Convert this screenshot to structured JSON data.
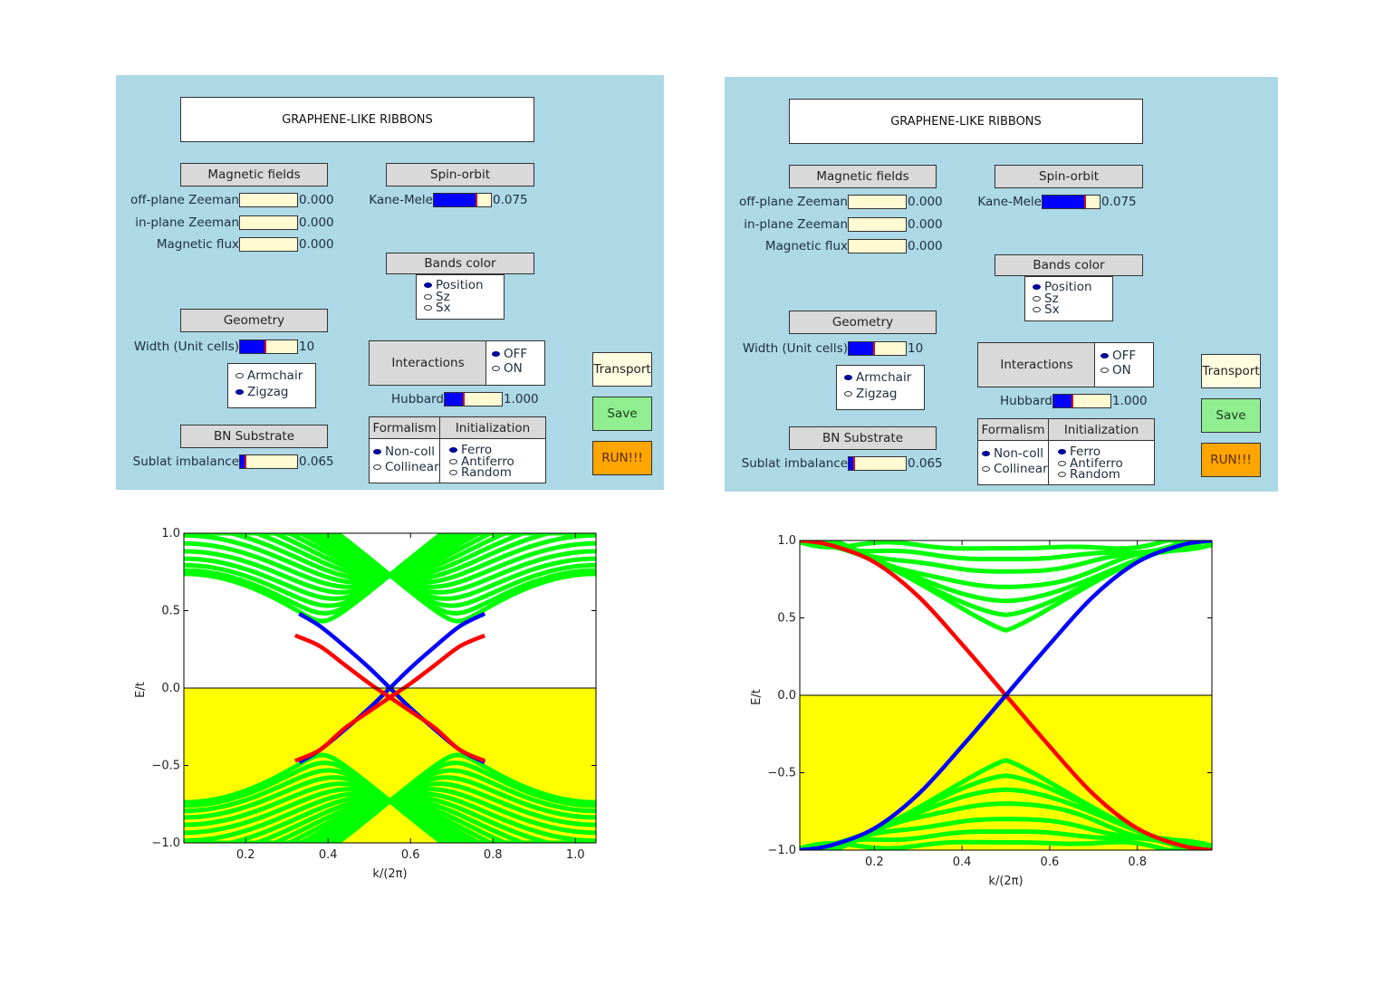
{
  "panels": [
    {
      "id": "left",
      "title": "GRAPHENE-LIKE RIBBONS",
      "magnetic_fields": {
        "header": "Magnetic fields",
        "sliders": [
          {
            "label": "off-plane Zeeman",
            "value": "0.000",
            "fraction": 0.0
          },
          {
            "label": "in-plane Zeeman",
            "value": "0.000",
            "fraction": 0.0
          },
          {
            "label": "Magnetic flux",
            "value": "0.000",
            "fraction": 0.0
          }
        ]
      },
      "spin_orbit": {
        "header": "Spin-orbit",
        "slider": {
          "label": "Kane-Mele",
          "value": "0.075",
          "fraction": 0.75
        }
      },
      "bands_color": {
        "header": "Bands color",
        "options": [
          {
            "label": "Position",
            "selected": true
          },
          {
            "label": "Sz",
            "selected": false
          },
          {
            "label": "Sx",
            "selected": false
          }
        ]
      },
      "geometry": {
        "header": "Geometry",
        "slider": {
          "label": "Width (Unit cells)",
          "value": "10",
          "fraction": 0.45
        },
        "options": [
          {
            "label": "Armchair",
            "selected": false
          },
          {
            "label": "Zigzag",
            "selected": true
          }
        ]
      },
      "bn_substrate": {
        "header": "BN Substrate",
        "slider": {
          "label": "Sublat imbalance",
          "value": "0.065",
          "fraction": 0.1
        }
      },
      "interactions": {
        "header": "Interactions",
        "options": [
          {
            "label": "OFF",
            "selected": true
          },
          {
            "label": "ON",
            "selected": false
          }
        ],
        "slider": {
          "label": "Hubbard",
          "value": "1.000",
          "fraction": 0.33
        }
      },
      "formalism": {
        "header": "Formalism",
        "options": [
          {
            "label": "Non-coll",
            "selected": true
          },
          {
            "label": "Collinear",
            "selected": false
          }
        ]
      },
      "initialization": {
        "header": "Initialization",
        "options": [
          {
            "label": "Ferro",
            "selected": true
          },
          {
            "label": "Antiferro",
            "selected": false
          },
          {
            "label": "Random",
            "selected": false
          }
        ]
      },
      "buttons": {
        "transport": "Transport",
        "save": "Save",
        "run": "RUN!!!"
      }
    },
    {
      "id": "right",
      "title": "GRAPHENE-LIKE RIBBONS",
      "magnetic_fields": {
        "header": "Magnetic fields",
        "sliders": [
          {
            "label": "off-plane Zeeman",
            "value": "0.000",
            "fraction": 0.0
          },
          {
            "label": "in-plane Zeeman",
            "value": "0.000",
            "fraction": 0.0
          },
          {
            "label": "Magnetic flux",
            "value": "0.000",
            "fraction": 0.0
          }
        ]
      },
      "spin_orbit": {
        "header": "Spin-orbit",
        "slider": {
          "label": "Kane-Mele",
          "value": "0.075",
          "fraction": 0.75
        }
      },
      "bands_color": {
        "header": "Bands color",
        "options": [
          {
            "label": "Position",
            "selected": true
          },
          {
            "label": "Sz",
            "selected": false
          },
          {
            "label": "Sx",
            "selected": false
          }
        ]
      },
      "geometry": {
        "header": "Geometry",
        "slider": {
          "label": "Width (Unit cells)",
          "value": "10",
          "fraction": 0.45
        },
        "options": [
          {
            "label": "Armchair",
            "selected": true
          },
          {
            "label": "Zigzag",
            "selected": false
          }
        ]
      },
      "bn_substrate": {
        "header": "BN Substrate",
        "slider": {
          "label": "Sublat imbalance",
          "value": "0.065",
          "fraction": 0.1
        }
      },
      "interactions": {
        "header": "Interactions",
        "options": [
          {
            "label": "OFF",
            "selected": true
          },
          {
            "label": "ON",
            "selected": false
          }
        ],
        "slider": {
          "label": "Hubbard",
          "value": "1.000",
          "fraction": 0.33
        }
      },
      "formalism": {
        "header": "Formalism",
        "options": [
          {
            "label": "Non-coll",
            "selected": true
          },
          {
            "label": "Collinear",
            "selected": false
          }
        ]
      },
      "initialization": {
        "header": "Initialization",
        "options": [
          {
            "label": "Ferro",
            "selected": true
          },
          {
            "label": "Antiferro",
            "selected": false
          },
          {
            "label": "Random",
            "selected": false
          }
        ]
      },
      "buttons": {
        "transport": "Transport",
        "save": "Save",
        "run": "RUN!!!"
      }
    }
  ],
  "colors": {
    "panel_bg": "#add8e6",
    "header_bg": "#d9d9d9",
    "slider_track": "#fffad2",
    "slider_fill": "#0000ff",
    "bulk_band": "#00ff00",
    "edge_left": "#0000ff",
    "edge_right": "#ff0000",
    "occupied_fill": "#ffff00",
    "transport_btn": "#fffde0",
    "save_btn": "#90ee90",
    "run_btn": "#ffa500"
  },
  "chart_data": [
    {
      "type": "line",
      "title": "",
      "xlabel": "k/(2π)",
      "ylabel": "E/t",
      "xlim": [
        0.05,
        1.05
      ],
      "ylim": [
        -1.0,
        1.0
      ],
      "xticks": [
        0.2,
        0.4,
        0.6,
        0.8,
        1.0
      ],
      "xtick_labels": [
        "0.2",
        "0.4",
        "0.6",
        "0.8",
        "1.0"
      ],
      "yticks": [
        -1.0,
        -0.5,
        0.0,
        0.5,
        1.0
      ],
      "ytick_labels": [
        "−1.0",
        "−0.5",
        "0.0",
        "0.5",
        "1.0"
      ],
      "grid": false,
      "fermi_level": 0.0,
      "fill_below_fermi": true,
      "model": {
        "edge": "zigzag",
        "width": 10,
        "kane_mele": 0.075,
        "sublattice_imbalance": 0.065,
        "k_center": 0.55
      },
      "edge_states": [
        {
          "name": "edge-state-blue",
          "color": "blue",
          "k": [
            0.33,
            0.38,
            0.44,
            0.5,
            0.55,
            0.6,
            0.66,
            0.72,
            0.78
          ],
          "E": [
            0.48,
            0.4,
            0.27,
            0.13,
            0.0,
            -0.13,
            -0.27,
            -0.4,
            -0.48
          ]
        },
        {
          "name": "edge-state-blue-2",
          "color": "blue",
          "k": [
            0.33,
            0.38,
            0.44,
            0.5,
            0.55,
            0.6,
            0.66,
            0.72,
            0.78
          ],
          "E": [
            -0.48,
            -0.4,
            -0.27,
            -0.13,
            0.0,
            0.13,
            0.27,
            0.4,
            0.48
          ]
        },
        {
          "name": "edge-state-red",
          "color": "red",
          "k": [
            0.32,
            0.38,
            0.44,
            0.5,
            0.55,
            0.6,
            0.66,
            0.72,
            0.78
          ],
          "E": [
            0.34,
            0.27,
            0.15,
            0.03,
            -0.06,
            -0.15,
            -0.26,
            -0.4,
            -0.47
          ]
        },
        {
          "name": "edge-state-red-2",
          "color": "red",
          "k": [
            0.32,
            0.38,
            0.44,
            0.5,
            0.55,
            0.6,
            0.66,
            0.72,
            0.78
          ],
          "E": [
            -0.47,
            -0.4,
            -0.26,
            -0.15,
            -0.06,
            0.03,
            0.15,
            0.27,
            0.34
          ]
        }
      ]
    },
    {
      "type": "line",
      "title": "",
      "xlabel": "k/(2π)",
      "ylabel": "E/t",
      "xlim": [
        0.03,
        0.97
      ],
      "ylim": [
        -1.0,
        1.0
      ],
      "xticks": [
        0.2,
        0.4,
        0.6,
        0.8
      ],
      "xtick_labels": [
        "0.2",
        "0.4",
        "0.6",
        "0.8"
      ],
      "yticks": [
        -1.0,
        -0.5,
        0.0,
        0.5,
        1.0
      ],
      "ytick_labels": [
        "−1.0",
        "−0.5",
        "0.0",
        "0.5",
        "1.0"
      ],
      "grid": false,
      "fermi_level": 0.0,
      "fill_below_fermi": true,
      "model": {
        "edge": "armchair",
        "width": 10,
        "kane_mele": 0.075,
        "sublattice_imbalance": 0.065,
        "k_center": 0.5
      },
      "edge_states": [
        {
          "name": "edge-state-red",
          "color": "red",
          "k": [
            0.03,
            0.1,
            0.2,
            0.3,
            0.4,
            0.5,
            0.6,
            0.7,
            0.8,
            0.9,
            0.97
          ],
          "E": [
            1.0,
            0.97,
            0.86,
            0.64,
            0.33,
            0.0,
            -0.33,
            -0.64,
            -0.86,
            -0.97,
            -1.0
          ]
        },
        {
          "name": "edge-state-blue",
          "color": "blue",
          "k": [
            0.03,
            0.1,
            0.2,
            0.3,
            0.4,
            0.5,
            0.6,
            0.7,
            0.8,
            0.9,
            0.97
          ],
          "E": [
            -1.0,
            -0.97,
            -0.86,
            -0.64,
            -0.33,
            0.0,
            0.33,
            0.64,
            0.86,
            0.97,
            1.0
          ]
        }
      ],
      "bulk_band_minima": [
        0.42,
        0.52,
        0.61,
        0.7,
        0.8,
        0.88,
        0.95
      ],
      "bulk_band_maxima_occupied": [
        -0.42,
        -0.52,
        -0.61,
        -0.7,
        -0.8,
        -0.88,
        -0.95
      ]
    }
  ]
}
